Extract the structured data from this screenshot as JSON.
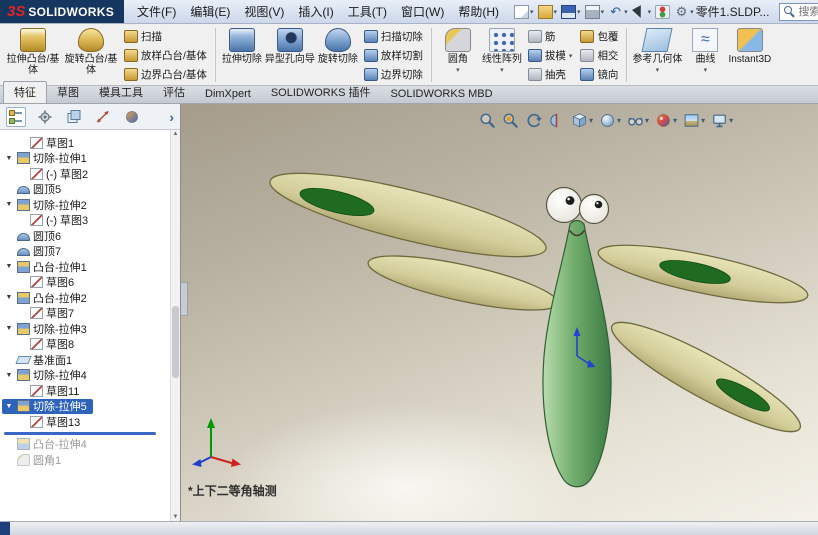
{
  "titlebar": {
    "logo_mark": "3S",
    "logo_text": "SOLIDWORKS",
    "menus": [
      "文件(F)",
      "编辑(E)",
      "视图(V)",
      "插入(I)",
      "工具(T)",
      "窗口(W)",
      "帮助(H)"
    ],
    "toolbar_icons": [
      "new-document",
      "open",
      "save",
      "print",
      "undo",
      "select",
      "rebuild",
      "options"
    ],
    "document_title": "零件1.SLDP...",
    "search_placeholder": "搜索 SOLID..."
  },
  "ribbon": {
    "groups": [
      {
        "big": [
          {
            "label": "拉伸凸台/基体"
          },
          {
            "label": "旋转凸台/基体"
          }
        ],
        "small": [
          {
            "label": "扫描"
          },
          {
            "label": "放样凸台/基体"
          },
          {
            "label": "边界凸台/基体"
          }
        ]
      },
      {
        "big": [
          {
            "label": "拉伸切除"
          },
          {
            "label": "异型孔向导"
          },
          {
            "label": "旋转切除"
          }
        ],
        "small": [
          {
            "label": "扫描切除"
          },
          {
            "label": "放样切割"
          },
          {
            "label": "边界切除"
          }
        ]
      },
      {
        "big": [
          {
            "label": "圆角"
          },
          {
            "label": "线性阵列"
          }
        ],
        "small": [
          {
            "label": "筋"
          },
          {
            "label": "拔模"
          },
          {
            "label": "抽壳"
          },
          {
            "label": "包覆"
          },
          {
            "label": "相交"
          },
          {
            "label": "镜向"
          }
        ]
      },
      {
        "big": [
          {
            "label": "参考几何体"
          },
          {
            "label": "曲线"
          },
          {
            "label": "Instant3D"
          }
        ]
      }
    ]
  },
  "tabs": {
    "items": [
      {
        "label": "特征",
        "active": true
      },
      {
        "label": "草图"
      },
      {
        "label": "模具工具"
      },
      {
        "label": "评估"
      },
      {
        "label": "DimXpert"
      },
      {
        "label": "SOLIDWORKS 插件"
      },
      {
        "label": "SOLIDWORKS MBD"
      }
    ]
  },
  "panel_tabs": [
    "featuremanager",
    "propertymanager",
    "configurationmanager",
    "dimxpertmanager",
    "displaymanager"
  ],
  "feature_tree": {
    "items": [
      {
        "label": "草图1",
        "type": "sketch",
        "level": 1
      },
      {
        "label": "切除-拉伸1",
        "type": "cut-extrude",
        "level": 0,
        "expanded": true
      },
      {
        "label": "(-) 草图2",
        "type": "sketch",
        "level": 1
      },
      {
        "label": "圆顶5",
        "type": "dome",
        "level": 0
      },
      {
        "label": "切除-拉伸2",
        "type": "cut-extrude",
        "level": 0,
        "expanded": true
      },
      {
        "label": "(-) 草图3",
        "type": "sketch",
        "level": 1
      },
      {
        "label": "圆顶6",
        "type": "dome",
        "level": 0
      },
      {
        "label": "圆顶7",
        "type": "dome",
        "level": 0
      },
      {
        "label": "凸台-拉伸1",
        "type": "boss-extrude",
        "level": 0,
        "expanded": true
      },
      {
        "label": "草图6",
        "type": "sketch",
        "level": 1
      },
      {
        "label": "凸台-拉伸2",
        "type": "boss-extrude",
        "level": 0,
        "expanded": true
      },
      {
        "label": "草图7",
        "type": "sketch",
        "level": 1
      },
      {
        "label": "切除-拉伸3",
        "type": "cut-extrude",
        "level": 0,
        "expanded": true
      },
      {
        "label": "草图8",
        "type": "sketch",
        "level": 1
      },
      {
        "label": "基准面1",
        "type": "plane",
        "level": 0
      },
      {
        "label": "切除-拉伸4",
        "type": "cut-extrude",
        "level": 0,
        "expanded": true
      },
      {
        "label": "草图11",
        "type": "sketch",
        "level": 1
      },
      {
        "label": "切除-拉伸5",
        "type": "cut-extrude",
        "level": 0,
        "expanded": true,
        "selected": true
      },
      {
        "label": "草图13",
        "type": "sketch",
        "level": 1
      },
      {
        "label": "凸台-拉伸4",
        "type": "boss-extrude",
        "level": 0,
        "grayed": true
      },
      {
        "label": "圆角1",
        "type": "fillet",
        "level": 0,
        "grayed": true
      }
    ]
  },
  "viewport": {
    "view_label": "*上下二等角轴测",
    "hud_icons": [
      "zoom-fit",
      "zoom-area",
      "previous-view",
      "section-view",
      "view-orientation",
      "display-style",
      "hide-show-items",
      "edit-appearance",
      "apply-scene",
      "view-settings"
    ],
    "model": {
      "name": "dragonfly",
      "body_color": "#72ad6c",
      "wing_color": "#d3cd9a",
      "wing_spot_color": "#1f6b21"
    }
  }
}
